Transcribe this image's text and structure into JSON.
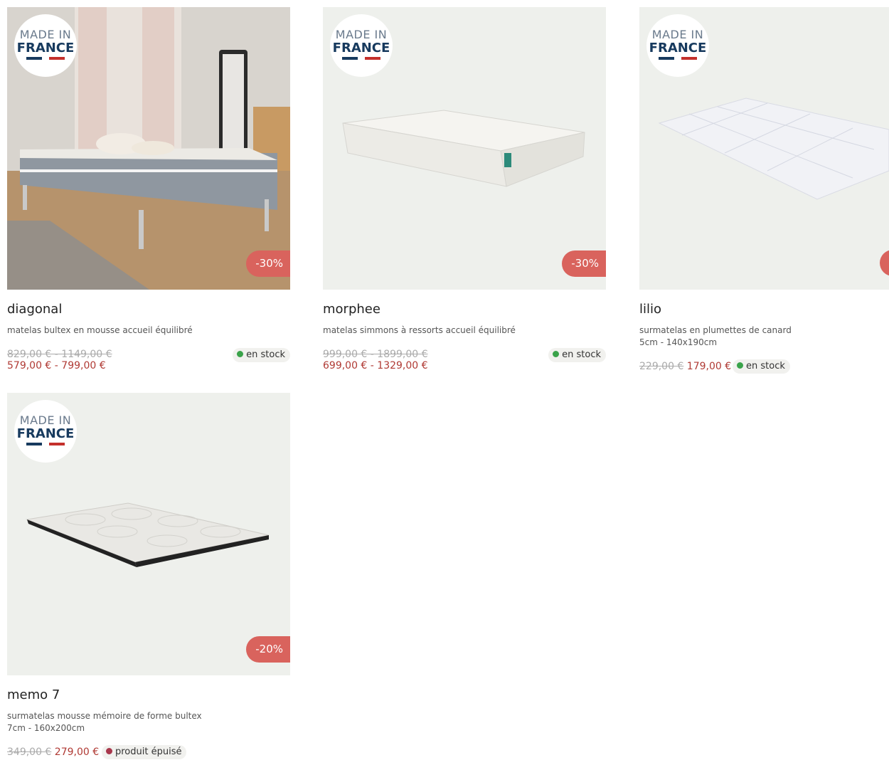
{
  "products": [
    {
      "made_in_line1": "MADE IN",
      "made_in_line2": "FRANCE",
      "discount": "-30%",
      "title": "diagonal",
      "description": "matelas bultex en mousse accueil équilibré",
      "old_price": "829,00 € - 1149,00 €",
      "new_price": "579,00 € - 799,00 €",
      "stock": "en stock"
    },
    {
      "made_in_line1": "MADE IN",
      "made_in_line2": "FRANCE",
      "discount": "-30%",
      "title": "morphee",
      "description": "matelas simmons à ressorts accueil équilibré",
      "old_price": "999,00 € - 1899,00 €",
      "new_price": "699,00 € - 1329,00 €",
      "stock": "en stock"
    },
    {
      "made_in_line1": "MADE IN",
      "made_in_line2": "FRANCE",
      "title": "lilio",
      "description": "surmatelas en plumettes de canard 5cm - 140x190cm",
      "old_price": "229,00 €",
      "new_price": "179,00 €",
      "stock": "en stock"
    },
    {
      "made_in_line1": "MADE IN",
      "made_in_line2": "FRANCE",
      "discount": "-20%",
      "title": "memo 7",
      "description": "surmatelas mousse mémoire de forme bultex 7cm - 160x200cm",
      "old_price": "349,00 €",
      "new_price": "279,00 €",
      "stock": "produit épuisé"
    }
  ],
  "colors": {
    "discount_bg": "#d9635d",
    "price_new": "#b03a34",
    "in_stock_dot": "#3aa34a",
    "sold_out_dot": "#a8374c"
  }
}
